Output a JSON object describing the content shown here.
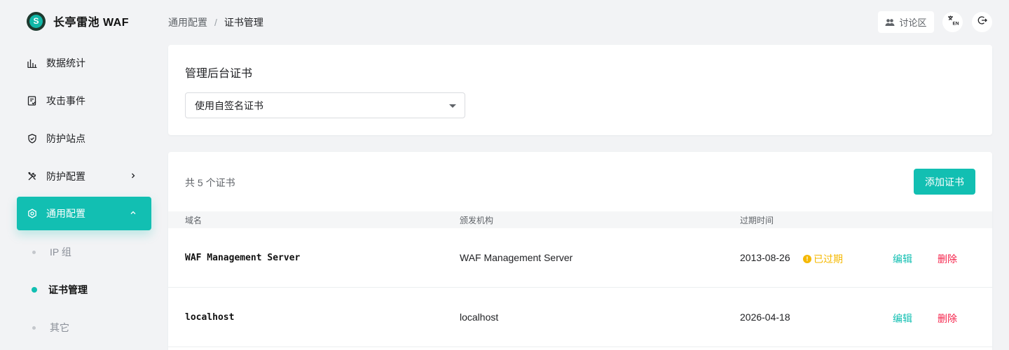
{
  "app": {
    "title": "长亭雷池 WAF",
    "logo_letter": "S"
  },
  "sidebar": {
    "items": [
      {
        "label": "数据统计",
        "icon": "bar-chart-icon"
      },
      {
        "label": "攻击事件",
        "icon": "document-check-icon"
      },
      {
        "label": "防护站点",
        "icon": "shield-icon"
      },
      {
        "label": "防护配置",
        "icon": "tools-icon"
      },
      {
        "label": "通用配置",
        "icon": "settings-icon"
      }
    ],
    "subitems": [
      {
        "label": "IP 组"
      },
      {
        "label": "证书管理"
      },
      {
        "label": "其它"
      }
    ]
  },
  "breadcrumb": {
    "parent": "通用配置",
    "separator": "/",
    "current": "证书管理"
  },
  "header": {
    "forum_label": "讨论区"
  },
  "admin_cert": {
    "title": "管理后台证书",
    "select_value": "使用自签名证书"
  },
  "certs": {
    "count_label": "共 5 个证书",
    "add_label": "添加证书",
    "columns": {
      "domain": "域名",
      "issuer": "颁发机构",
      "expiry": "过期时间"
    },
    "rows": [
      {
        "domain": "WAF Management Server",
        "issuer": "WAF Management Server",
        "expiry": "2013-08-26",
        "status": "已过期",
        "edit": "编辑",
        "delete": "删除"
      },
      {
        "domain": "localhost",
        "issuer": "localhost",
        "expiry": "2026-04-18",
        "status": "",
        "edit": "编辑",
        "delete": "删除"
      }
    ]
  },
  "colors": {
    "accent": "#12bfb2",
    "danger": "#f5224a",
    "warning": "#f5b800"
  }
}
